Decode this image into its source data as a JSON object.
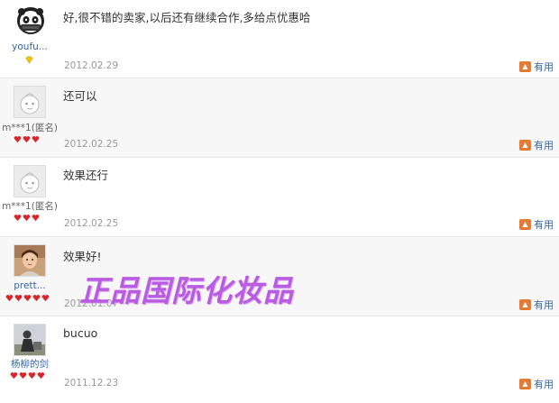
{
  "reviews": [
    {
      "username": "youfu...",
      "content": "好,很不错的卖家,以后还有继续合作,多给点优惠哈",
      "date": "2012.02.29",
      "useful_label": "有用",
      "avatar": "panda-avatar",
      "badge": "yellow-diamond",
      "badge_count": 1
    },
    {
      "username": "m***1(匿名)",
      "content": "还可以",
      "date": "2012.02.25",
      "useful_label": "有用",
      "avatar": "default-avatar",
      "badge": "red-heart",
      "badge_count": 3
    },
    {
      "username": "m***1(匿名)",
      "content": "效果还行",
      "date": "2012.02.25",
      "useful_label": "有用",
      "avatar": "default-avatar",
      "badge": "red-heart",
      "badge_count": 3
    },
    {
      "username": "prett...",
      "content": "效果好!",
      "date": "2012.01.07",
      "useful_label": "有用",
      "avatar": "photo-avatar",
      "badge": "red-heart",
      "badge_count": 5
    },
    {
      "username": "杨柳的剑",
      "content": "bucuo",
      "date": "2011.12.23",
      "useful_label": "有用",
      "avatar": "photo-avatar",
      "badge": "red-heart",
      "badge_count": 4
    }
  ],
  "watermark": "正品国际化妆品",
  "colors": {
    "link": "#3366aa",
    "date": "#999999",
    "useful_icon": "#e57a33",
    "watermark": "#b44fe0",
    "heart": "#d9262c",
    "diamond": "#f2c200"
  }
}
